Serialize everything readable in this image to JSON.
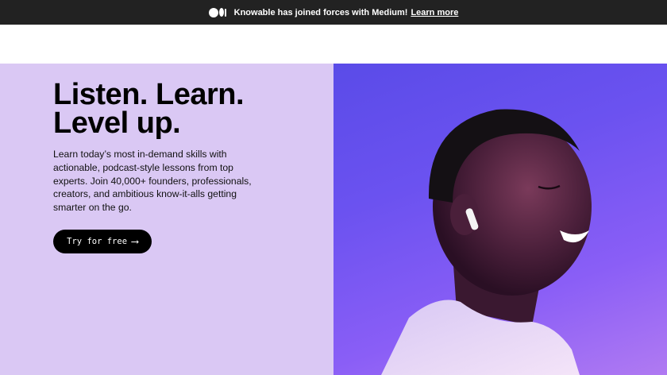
{
  "banner": {
    "logo_icon": "medium-logo-icon",
    "message": "Knowable has joined forces with Medium!",
    "link_label": "Learn more"
  },
  "hero": {
    "headline_line1": "Listen. Learn.",
    "headline_line2": "Level up.",
    "description": "Learn today’s most in-demand skills with actionable, podcast-style lessons from top experts. Join 40,000+ founders, professionals, creators, and ambitious know-it-alls getting smarter on the go.",
    "cta_label": "Try for free",
    "cta_icon": "arrow-right-icon",
    "image": "photo of a smiling man wearing a wireless earbud against a purple background"
  },
  "colors": {
    "banner_bg": "#222222",
    "hero_left_bg": "#dac8f4",
    "cta_bg": "#000000",
    "photo_bg": "#6b52f0"
  }
}
